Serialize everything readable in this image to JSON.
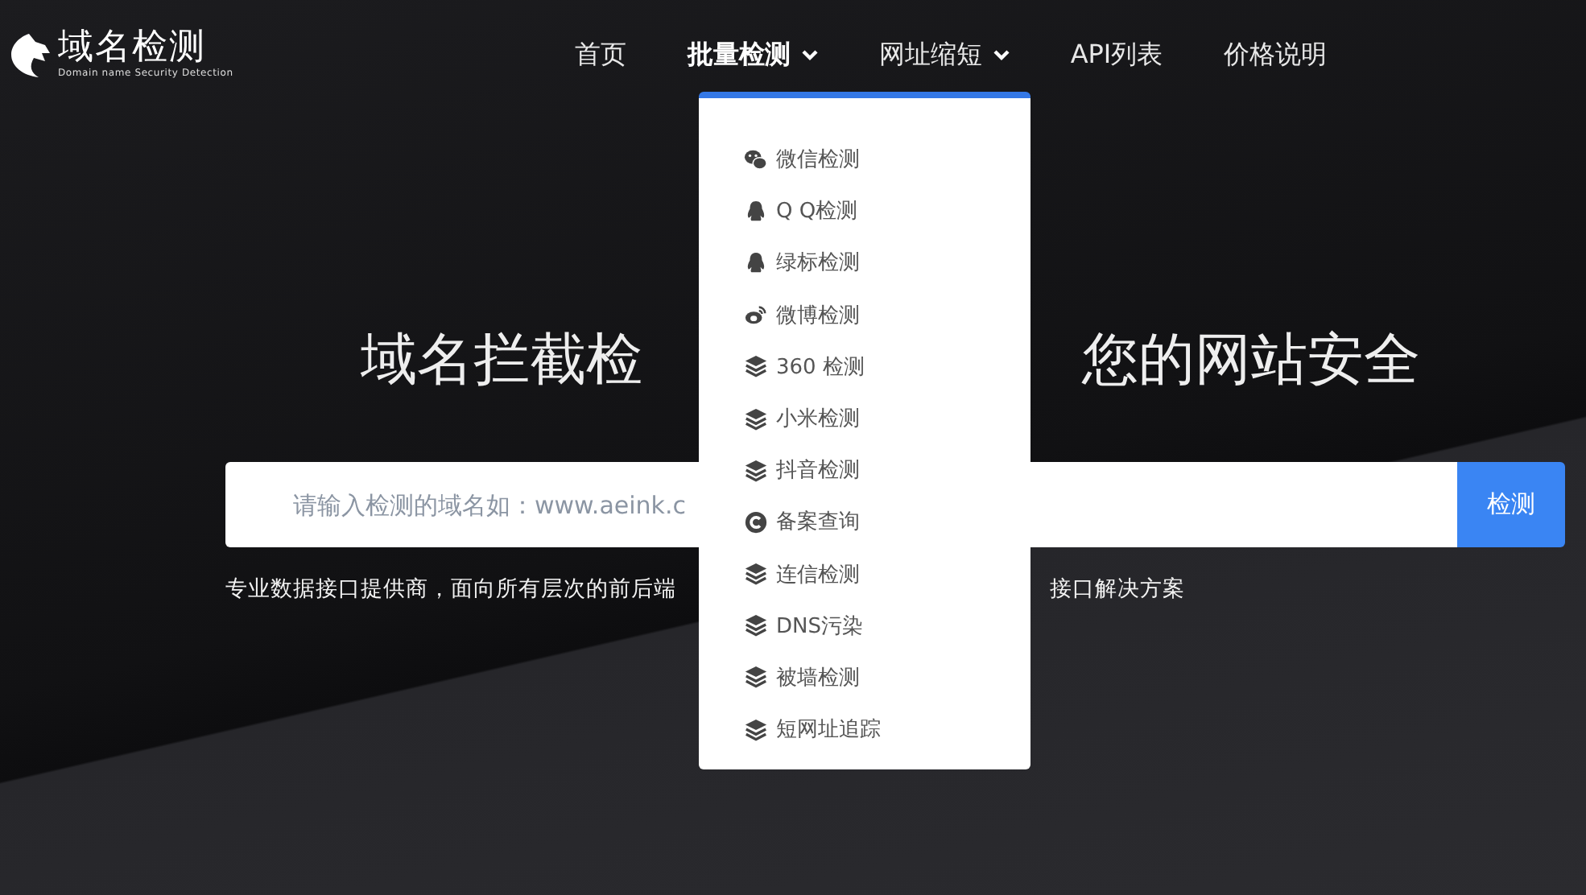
{
  "logo": {
    "title": "域名检测",
    "subtitle": "Domain name Security Detection"
  },
  "nav": [
    {
      "label": "首页",
      "kind": "link"
    },
    {
      "label": "批量检测",
      "kind": "menu",
      "expanded": true
    },
    {
      "label": "网址缩短",
      "kind": "menu",
      "expanded": false
    },
    {
      "label": "API列表",
      "kind": "link"
    },
    {
      "label": "价格说明",
      "kind": "link"
    }
  ],
  "dropdown": {
    "items": [
      {
        "label": "微信检测",
        "kind": "wechat"
      },
      {
        "label": "Q Q检测",
        "kind": "qq"
      },
      {
        "label": "绿标检测",
        "kind": "qq"
      },
      {
        "label": "微博检测",
        "kind": "weibo"
      },
      {
        "label": "360 检测",
        "kind": "layers"
      },
      {
        "label": "小米检测",
        "kind": "layers"
      },
      {
        "label": "抖音检测",
        "kind": "layers"
      },
      {
        "label": "备案查询",
        "kind": "copyright"
      },
      {
        "label": "连信检测",
        "kind": "layers"
      },
      {
        "label": "DNS污染",
        "kind": "layers"
      },
      {
        "label": "被墙检测",
        "kind": "layers"
      },
      {
        "label": "短网址追踪",
        "kind": "layers"
      }
    ]
  },
  "hero": {
    "title_parts": [
      "域名拦截检",
      "您的网站安全"
    ],
    "search": {
      "placeholder": "请输入检测的域名如：www.aeink.c",
      "button": "检测"
    },
    "subtitle_parts": [
      "专业数据接口提供商，面向所有层次的前后端",
      "接口解决方案"
    ]
  }
}
